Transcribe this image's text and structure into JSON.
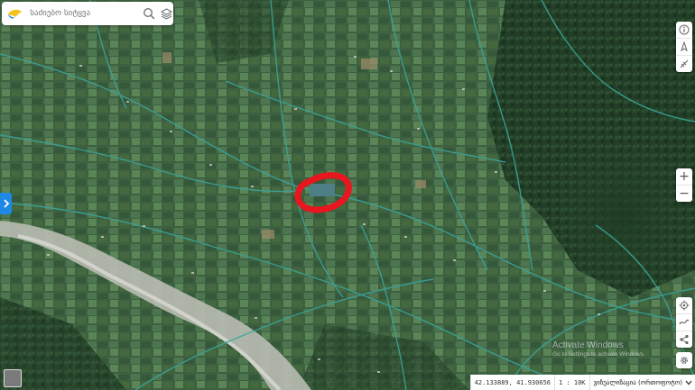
{
  "search": {
    "placeholder": "საძიებო სიტყვა"
  },
  "map": {
    "marker_color": "#e8161e",
    "accent": "#1e88e5"
  },
  "status": {
    "coordinates": "42.133889, 41.930656",
    "scale": "1 : 10K",
    "layer": "ვიზუალიზაცია (ორთოფოტო)"
  },
  "watermark": {
    "title": "Activate Windows",
    "subtitle": "Go to Settings to activate Windows."
  }
}
